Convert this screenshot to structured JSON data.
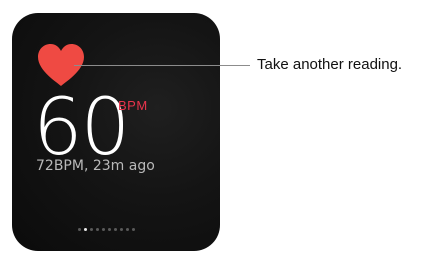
{
  "watch": {
    "heart_icon": "heart-icon",
    "heart_color": "#ef4a43",
    "bpm_value": "60",
    "bpm_unit": "BPM",
    "unit_color": "#e8344c",
    "last_reading": "72BPM, 23m ago",
    "page_indicator": {
      "count": 10,
      "active_index": 1
    }
  },
  "callout": {
    "label": "Take another reading."
  }
}
